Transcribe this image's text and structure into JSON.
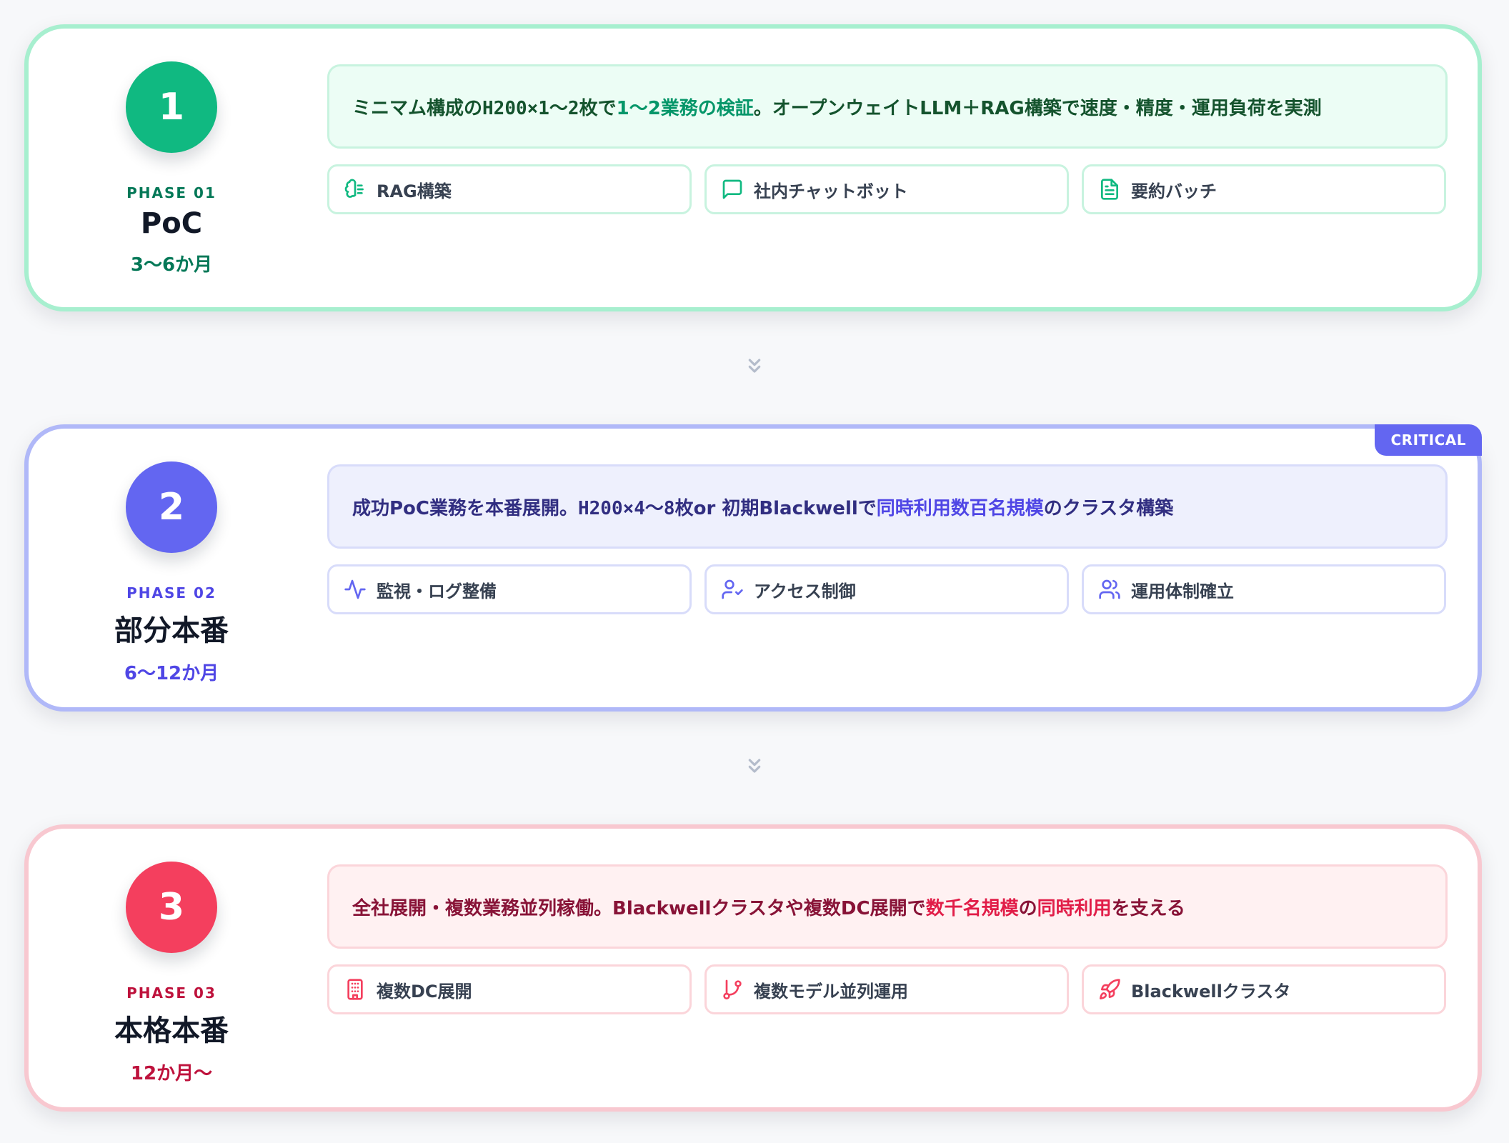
{
  "phases": [
    {
      "number": "1",
      "phase_label": "PHASE 01",
      "name": "PoC",
      "duration": "3〜6か月",
      "desc": {
        "part1": "ミニマム構成の ",
        "part2": "H200×1〜2枚",
        "part3": " で ",
        "part4": "1〜2業務の検証",
        "part5": "。オープンウェイトLLM＋RAG構築で速度・精度・運用負荷を実測"
      },
      "tags": [
        {
          "label": "RAG構築",
          "icon": "brain-icon"
        },
        {
          "label": "社内チャットボット",
          "icon": "chat-icon"
        },
        {
          "label": "要約バッチ",
          "icon": "document-icon"
        }
      ]
    },
    {
      "number": "2",
      "phase_label": "PHASE 02",
      "name": "部分本番",
      "duration": "6〜12か月",
      "badge": "CRITICAL",
      "desc": {
        "part1": "成功PoC業務を本番展開。",
        "part2": "H200×4〜8枚",
        "part3": " or 初期Blackwellで",
        "part4": "同時利用数百名規模",
        "part5": "のクラスタ構築"
      },
      "tags": [
        {
          "label": "監視・ログ整備",
          "icon": "activity-icon"
        },
        {
          "label": "アクセス制御",
          "icon": "user-check-icon"
        },
        {
          "label": "運用体制確立",
          "icon": "users-icon"
        }
      ]
    },
    {
      "number": "3",
      "phase_label": "PHASE 03",
      "name": "本格本番",
      "duration": "12か月〜",
      "desc": {
        "part1": "全社展開・複数業務並列稼働。Blackwellクラスタや複数DC展開で",
        "part2": "数千名規模",
        "part3": "の",
        "part4": "同時利用",
        "part5": "を支える"
      },
      "tags": [
        {
          "label": "複数DC展開",
          "icon": "building-icon"
        },
        {
          "label": "複数モデル並列運用",
          "icon": "git-branch-icon"
        },
        {
          "label": "Blackwellクラスタ",
          "icon": "rocket-icon"
        }
      ]
    }
  ],
  "connectors": [
    "chevrons-down-icon",
    "chevrons-down-icon"
  ]
}
